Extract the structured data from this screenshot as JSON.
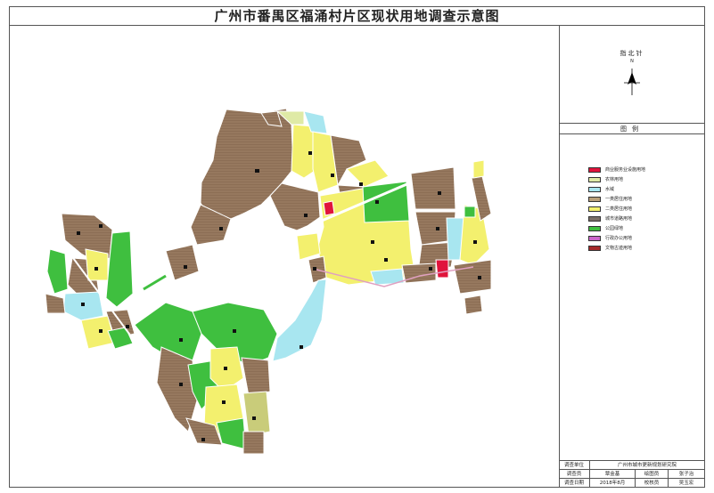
{
  "title": "广州市番禺区福涌村片区现状用地调查示意图",
  "north_arrow": {
    "label": "指北针",
    "n": "N",
    "icon": "north-arrow-icon"
  },
  "legend": {
    "heading": "图例",
    "items": [
      {
        "label": "商业服务业设施用地",
        "color": "#e0143c"
      },
      {
        "label": "农林用地",
        "color": "#dfeaa6"
      },
      {
        "label": "水域",
        "color": "#a8e6f0"
      },
      {
        "label": "一类居住用地",
        "color": "#b9a07a"
      },
      {
        "label": "二类居住用地",
        "color": "#f3f06e"
      },
      {
        "label": "城市道路用地",
        "color": "#7a6f66"
      },
      {
        "label": "公园绿地",
        "color": "#3fbf3f"
      },
      {
        "label": "行政办公用地",
        "color": "#cc66cc"
      },
      {
        "label": "文物古迹用地",
        "color": "#a52a2a"
      }
    ]
  },
  "info_block": {
    "survey_unit_label": "调查单位",
    "survey_unit_value": "广州市城市更新规划研究院",
    "surveyor_label": "调查员",
    "surveyor_value": "覃金基",
    "drawer_label": "绘图员",
    "drawer_value": "张子治",
    "date_label": "调查日期",
    "date_value": "2018年8月",
    "checker_label": "校核员",
    "checker_value": "吴玉宏"
  },
  "map_colors": {
    "residential_brown": "#8c6e55",
    "residential_yellow": "#f3f06e",
    "green": "#3fbf3f",
    "water": "#a8e6f0",
    "pale_green": "#dfeaa6",
    "commercial": "#e0143c",
    "road_light": "#dddddd"
  }
}
